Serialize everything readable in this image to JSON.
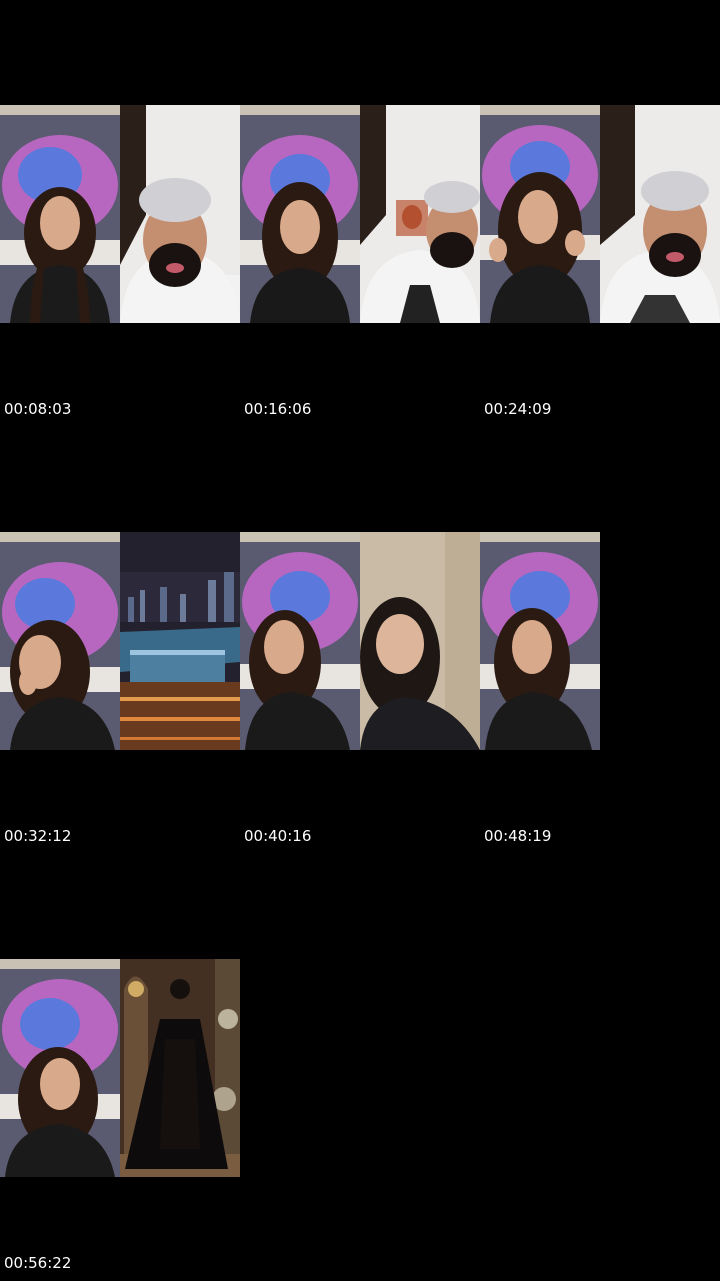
{
  "timestamps": [
    "00:08:03",
    "00:16:06",
    "00:24:09",
    "00:32:12",
    "00:40:16",
    "00:48:19",
    "00:56:22"
  ],
  "frames": [
    {
      "kind": "woman-galaxy",
      "hand": "none",
      "top": "#1b1b1b"
    },
    {
      "kind": "man-white"
    },
    {
      "kind": "woman-galaxy",
      "hand": "none",
      "top": "#191919"
    },
    {
      "kind": "man-art"
    },
    {
      "kind": "woman-galaxy",
      "hand": "hair"
    },
    {
      "kind": "man-white"
    },
    {
      "kind": "woman-galaxy",
      "hand": "face"
    },
    {
      "kind": "city-night"
    },
    {
      "kind": "woman-galaxy",
      "hand": "none"
    },
    {
      "kind": "woman-plain"
    },
    {
      "kind": "woman-galaxy",
      "hand": "none"
    },
    {
      "kind": "woman-galaxy",
      "hand": "none"
    },
    {
      "kind": "dress-palace"
    }
  ],
  "colors": {
    "background": "#000000",
    "timestamp_text": "#ffffff",
    "galaxy_pink": "#d06ad6",
    "galaxy_blue": "#4a7ce0"
  }
}
